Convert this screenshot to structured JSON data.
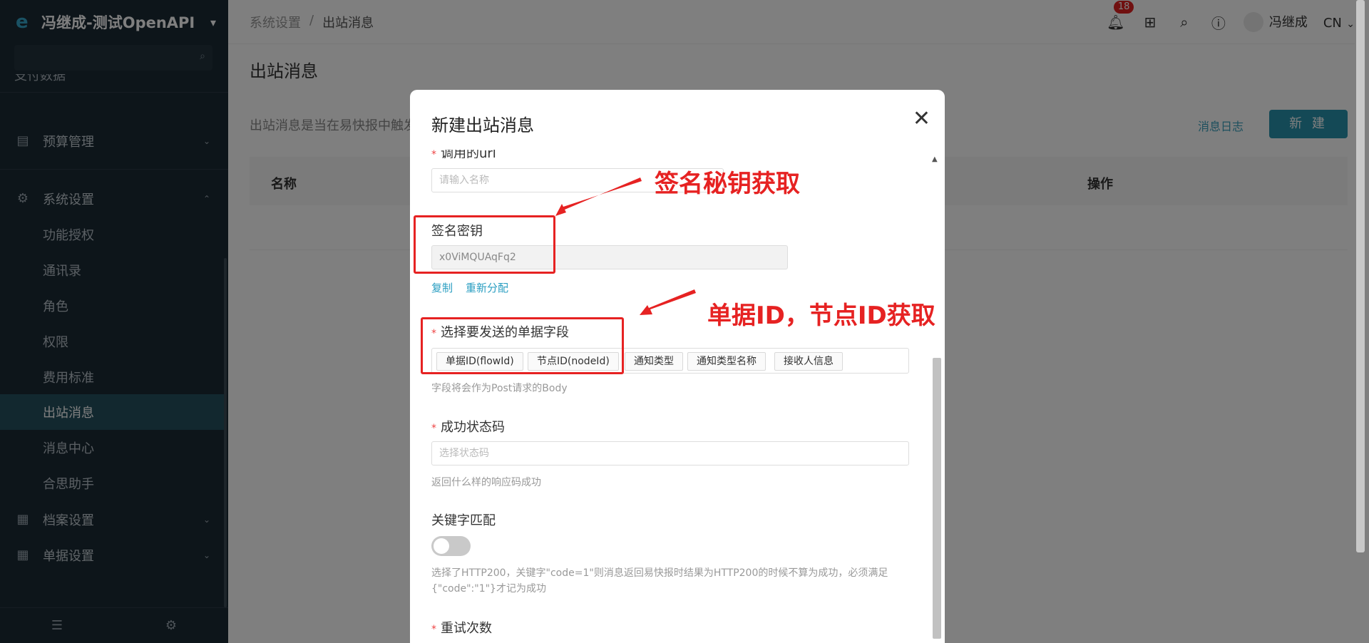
{
  "app": {
    "title": "冯继成-测试OpenAPI"
  },
  "sidebar": {
    "partial_item": "支付数据",
    "budget": "预算管理",
    "system": "系统设置",
    "items": [
      "功能授权",
      "通讯录",
      "角色",
      "权限",
      "费用标准",
      "出站消息",
      "消息中心",
      "合思助手"
    ],
    "archive": "档案设置",
    "document": "单据设置"
  },
  "topbar": {
    "breadcrumb": [
      "系统设置",
      "出站消息"
    ],
    "breadcrumb_sep": "/",
    "badge_count": "18",
    "user": "冯继成",
    "lang": "CN"
  },
  "page": {
    "title": "出站消息",
    "desc": "出站消息是当在易快报中触发",
    "msg_log": "消息日志",
    "new_button": "新 建",
    "col_name": "名称",
    "col_op": "操作"
  },
  "modal": {
    "title": "新建出站消息",
    "url_label": "调用的url",
    "name_placeholder": "请输入名称",
    "secret_label": "签名密钥",
    "secret_value": "x0ViMQUAqFq2",
    "copy": "复制",
    "reassign": "重新分配",
    "fields_label": "选择要发送的单据字段",
    "tags": [
      "单据ID(flowId)",
      "节点ID(nodeId)",
      "通知类型",
      "通知类型名称",
      "接收人信息"
    ],
    "fields_hint": "字段将会作为Post请求的Body",
    "status_label": "成功状态码",
    "status_placeholder": "选择状态码",
    "status_hint": "返回什么样的响应码成功",
    "keyword_label": "关键字匹配",
    "keyword_hint1": "选择了HTTP200，关键字\"code=1\"则消息返回易快报时结果为HTTP200的时候不算为成功，必须满足",
    "keyword_hint2": "{\"code\":\"1\"}才记为成功",
    "retry_label": "重试次数"
  },
  "annotations": {
    "secret": "签名秘钥获取",
    "ids": "单据ID，节点ID获取"
  },
  "colors": {
    "accent": "#2993ad",
    "annotation": "#e62222",
    "sidebar_bg": "#1b2a35"
  }
}
